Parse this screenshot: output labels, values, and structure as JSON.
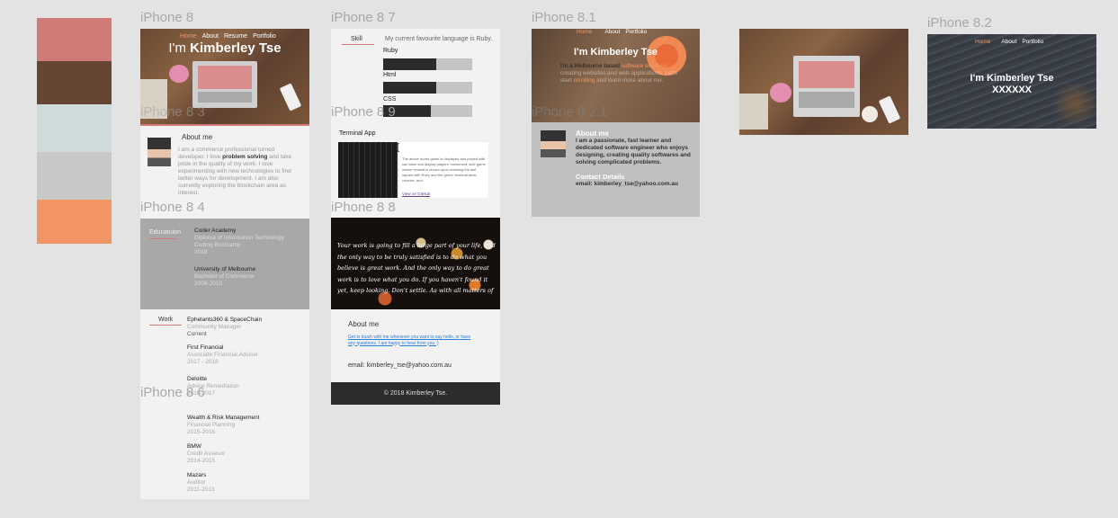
{
  "palette": [
    "#d17b78",
    "#664633",
    "#cfdbdb",
    "#c8c8c8",
    "#f29665"
  ],
  "artboards": {
    "a1": "iPhone 8",
    "a2": "iPhone 8 3",
    "a3": "iPhone 8 4",
    "a4": "iPhone 8 5",
    "a5": "iPhone 8 6",
    "a6": "iPhone 8 7",
    "a7": "iPhone 8 9",
    "a8": "iPhone 8 8",
    "a9": "iPhone 8.1",
    "a10": "iPhone 8 2.1",
    "a11": "iPhone 8.2"
  },
  "nav": {
    "home": "Home",
    "about": "About",
    "resume": "Resume",
    "portfolio": "Portfolio"
  },
  "hero": {
    "prefix": "I'm ",
    "name": "Kimberley Tse",
    "full": "I'm Kimberley Tse",
    "xx": "XXXXXX"
  },
  "about": {
    "heading": "About me",
    "body_1": "I am a commerce professional turned developer. I love ",
    "body_bold": "problem solving",
    "body_2": " and take pride in the quality of my work. I love experimenting with new technologies to find better ways for development. I am also currently exploring the blockchain area as interest."
  },
  "education": {
    "label": "Educatuion",
    "items": [
      {
        "title": "Coder Academy",
        "sub": "Diploma of Information Technology",
        "sub2": "Coding Bootcamp",
        "year": "2018"
      },
      {
        "title": "University of Melbourne",
        "sub": "Bachelor of Commerce",
        "year": "2008-2010"
      }
    ]
  },
  "work": {
    "label": "Work",
    "items": [
      {
        "title": "Ephelants360 & SpaceChain",
        "sub": "Community Manager",
        "year": "Current"
      },
      {
        "title": "First Financial",
        "sub": "Associate Financial Adviser",
        "year": "2017 - 2018"
      },
      {
        "title": "Deloitte",
        "sub": "Advice Remediation",
        "year": "2016-2017"
      },
      {
        "title": "Wealth & Risk Management",
        "sub": "Financial Planning",
        "year": "2015-2016"
      },
      {
        "title": "BMW",
        "sub": "Credit Assesor",
        "year": "2014-2015"
      },
      {
        "title": "Mazars",
        "sub": "Auditor",
        "year": "2011-2013"
      }
    ]
  },
  "skills": {
    "label": "Skill",
    "intro": "My current favourite language is Ruby.",
    "items": [
      {
        "name": "Ruby",
        "level": 0.6
      },
      {
        "name": "Html",
        "level": 0.6
      },
      {
        "name": "CSS",
        "level": 0.54
      }
    ]
  },
  "terminal": {
    "label": "Terminal App",
    "desc": "The above board game is displayed and played with can track and display players' movement, side game winner reward is shown upon reaching the last square with Ruby and the gems: terminal-table, colorize, and",
    "link": "View on GitHub"
  },
  "quote": "Your work is going to fill a large part of your life, and the only way to be truly satisfied is to do what you believe is great work. And the only way to do great work is to love what you do. If you haven't found it yet, keep looking. Don't settle. As with all matters of the heart, you'll know when you find it.",
  "contact_page": {
    "heading": "About me",
    "link_text": "Get in touch with me whenever you want to say hello, or have any questions. I am happy to hear from you :)",
    "email": "email: kimberley_tse@yahoo.com.au",
    "footer": "© 2018 Kimberley Tse."
  },
  "page81": {
    "intro_1": "I'm a Melbourne based ",
    "intro_hl": "software engineer",
    "intro_2": " creating websites and web applications. Let's start ",
    "intro_hl2": "scrolling",
    "intro_3": " and learn more about me."
  },
  "about2": {
    "heading": "About me",
    "body": "I am a passionate, fast learner and dedicated software engineer who enjoys designing, creating quality softwares and solving complicated problems.",
    "contact_heading": "Contact Details",
    "email": "email: kimberley_tse@yahoo.com.au"
  }
}
